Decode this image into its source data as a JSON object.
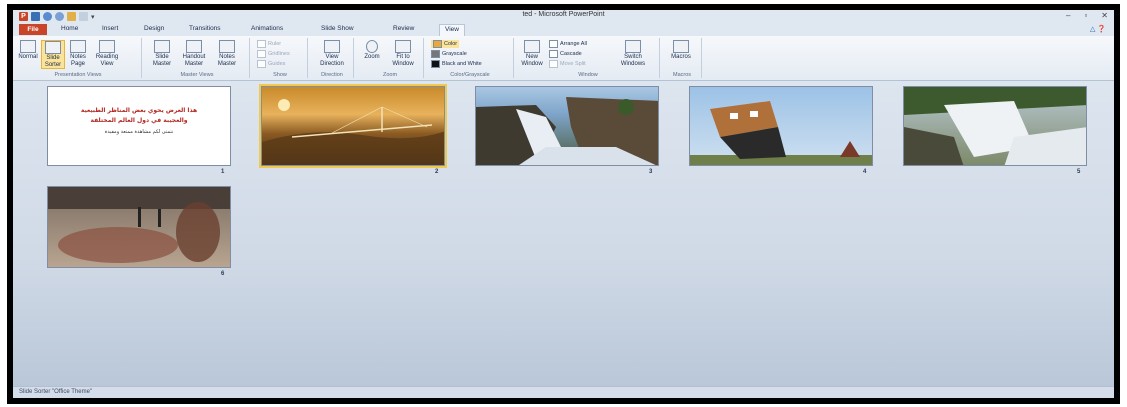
{
  "window": {
    "title": "ted - Microsoft PowerPoint",
    "controls": [
      "–",
      "▫",
      "✕"
    ]
  },
  "tabs": {
    "file": "File",
    "items": [
      "Home",
      "Insert",
      "Design",
      "Transitions",
      "Animations",
      "Slide Show",
      "Review",
      "View"
    ],
    "active": "View"
  },
  "ribbon": {
    "presentation_views": {
      "label": "Presentation Views",
      "normal": "Normal",
      "slide_sorter_1": "Slide",
      "slide_sorter_2": "Sorter",
      "notes_page_1": "Notes",
      "notes_page_2": "Page",
      "reading_view_1": "Reading",
      "reading_view_2": "View"
    },
    "master_views": {
      "label": "Master Views",
      "slide_master_1": "Slide",
      "slide_master_2": "Master",
      "handout_master_1": "Handout",
      "handout_master_2": "Master",
      "notes_master_1": "Notes",
      "notes_master_2": "Master"
    },
    "show": {
      "label": "Show",
      "ruler": "Ruler",
      "gridlines": "Gridlines",
      "guides": "Guides"
    },
    "direction": {
      "label": "Direction",
      "view_direction_1": "View",
      "view_direction_2": "Direction"
    },
    "zoom": {
      "label": "Zoom",
      "zoom": "Zoom",
      "fit_1": "Fit to",
      "fit_2": "Window"
    },
    "color": {
      "label": "Color/Grayscale",
      "color": "Color",
      "grayscale": "Grayscale",
      "bw": "Black and White"
    },
    "window": {
      "label": "Window",
      "new_1": "New",
      "new_2": "Window",
      "arrange_all": "Arrange All",
      "cascade": "Cascade",
      "move_split": "Move Split",
      "switch_1": "Switch",
      "switch_2": "Windows"
    },
    "macros": {
      "label": "Macros",
      "macros": "Macros"
    }
  },
  "slides": [
    {
      "number": "1",
      "arabic_1": "هذا العرض يحوي بعض المناظر الطبيعية",
      "arabic_2": "والعجيبة في دول العالم المختلفة",
      "arabic_3": "نتمنى لكم مشاهدة ممتعة ومفيدة"
    },
    {
      "number": "2"
    },
    {
      "number": "3"
    },
    {
      "number": "4"
    },
    {
      "number": "5"
    },
    {
      "number": "6"
    }
  ],
  "status": {
    "text": "Slide Sorter   \"Office Theme\""
  }
}
